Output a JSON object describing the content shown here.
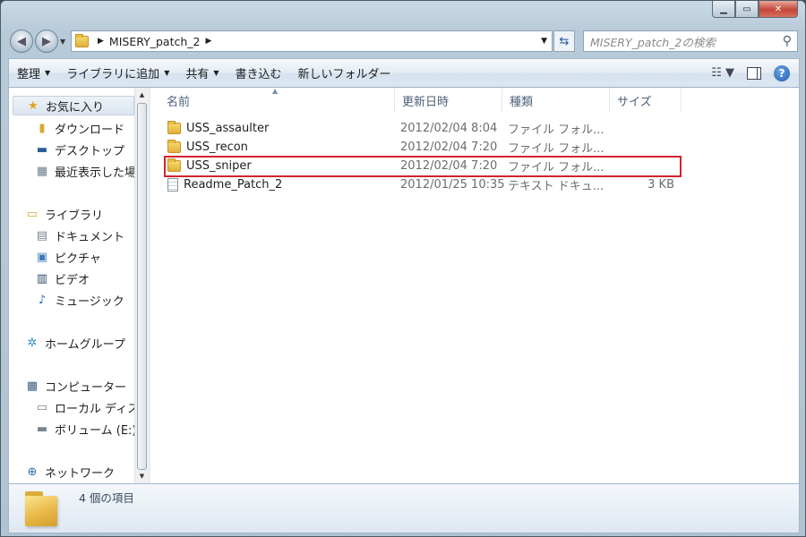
{
  "window": {
    "caption_buttons": {
      "minimize": "▁",
      "maximize": "▭",
      "close": "✕"
    }
  },
  "address_bar": {
    "path": [
      "MISERY_patch_2"
    ],
    "search_placeholder": "MISERY_patch_2の検索"
  },
  "toolbar": {
    "organize": "整理",
    "add_to_library": "ライブラリに追加",
    "share": "共有",
    "burn": "書き込む",
    "new_folder": "新しいフォルダー"
  },
  "nav": {
    "favorites": "お気に入り",
    "downloads": "ダウンロード",
    "desktop": "デスクトップ",
    "recent": "最近表示した場所",
    "libraries": "ライブラリ",
    "documents": "ドキュメント",
    "pictures": "ピクチャ",
    "videos": "ビデオ",
    "music": "ミュージック",
    "homegroup": "ホームグループ",
    "computer": "コンピューター",
    "local_disk": "ローカル ディスク",
    "volume_e": "ボリューム (E:)",
    "network": "ネットワーク"
  },
  "columns": {
    "name": "名前",
    "modified": "更新日時",
    "type": "種類",
    "size": "サイズ"
  },
  "files": [
    {
      "name": "USS_assaulter",
      "date": "2012/02/04 8:04",
      "type": "ファイル フォル...",
      "size": "",
      "kind": "folder"
    },
    {
      "name": "USS_recon",
      "date": "2012/02/04 7:20",
      "type": "ファイル フォル...",
      "size": "",
      "kind": "folder"
    },
    {
      "name": "USS_sniper",
      "date": "2012/02/04 7:20",
      "type": "ファイル フォル...",
      "size": "",
      "kind": "folder",
      "highlighted": true
    },
    {
      "name": "Readme_Patch_2",
      "date": "2012/01/25 10:35",
      "type": "テキスト ドキュ...",
      "size": "3 KB",
      "kind": "text"
    }
  ],
  "details": {
    "item_count": "4 個の項目"
  },
  "colors": {
    "highlight_border": "#d3232d",
    "frame": "#b7cad9"
  }
}
